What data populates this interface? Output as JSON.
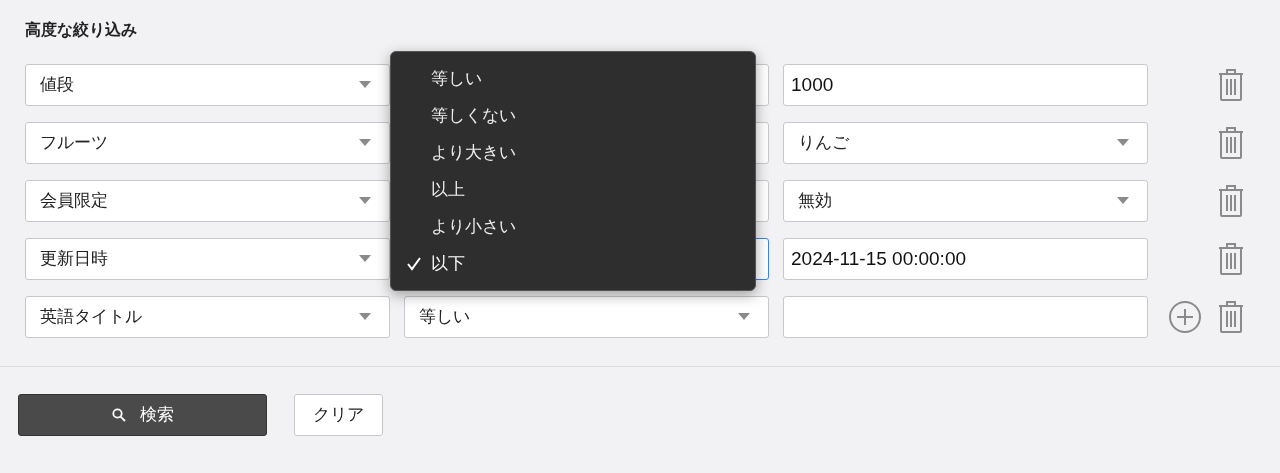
{
  "title": "高度な絞り込み",
  "filters": [
    {
      "field": "値段",
      "operator": {
        "focused": false
      },
      "value": {
        "kind": "input",
        "text": "1000"
      },
      "can_add": false
    },
    {
      "field": "フルーツ",
      "operator": {
        "focused": false
      },
      "value": {
        "kind": "select",
        "text": "りんご"
      },
      "can_add": false
    },
    {
      "field": "会員限定",
      "operator": {
        "focused": false
      },
      "value": {
        "kind": "select",
        "text": "無効"
      },
      "can_add": false
    },
    {
      "field": "更新日時",
      "operator": {
        "focused": true
      },
      "value": {
        "kind": "input",
        "text": "2024-11-15 00:00:00"
      },
      "can_add": false
    },
    {
      "field": "英語タイトル",
      "operator": {
        "focused": false,
        "text": "等しい"
      },
      "value": {
        "kind": "input"
      },
      "can_add": true
    }
  ],
  "operator_menu": [
    {
      "label": "等しい",
      "selected": false
    },
    {
      "label": "等しくない",
      "selected": false
    },
    {
      "label": "より大きい",
      "selected": false
    },
    {
      "label": "以上",
      "selected": false
    },
    {
      "label": "より小さい",
      "selected": false
    },
    {
      "label": "以下",
      "selected": true
    }
  ],
  "search_button": "検索",
  "clear_button": "クリア"
}
